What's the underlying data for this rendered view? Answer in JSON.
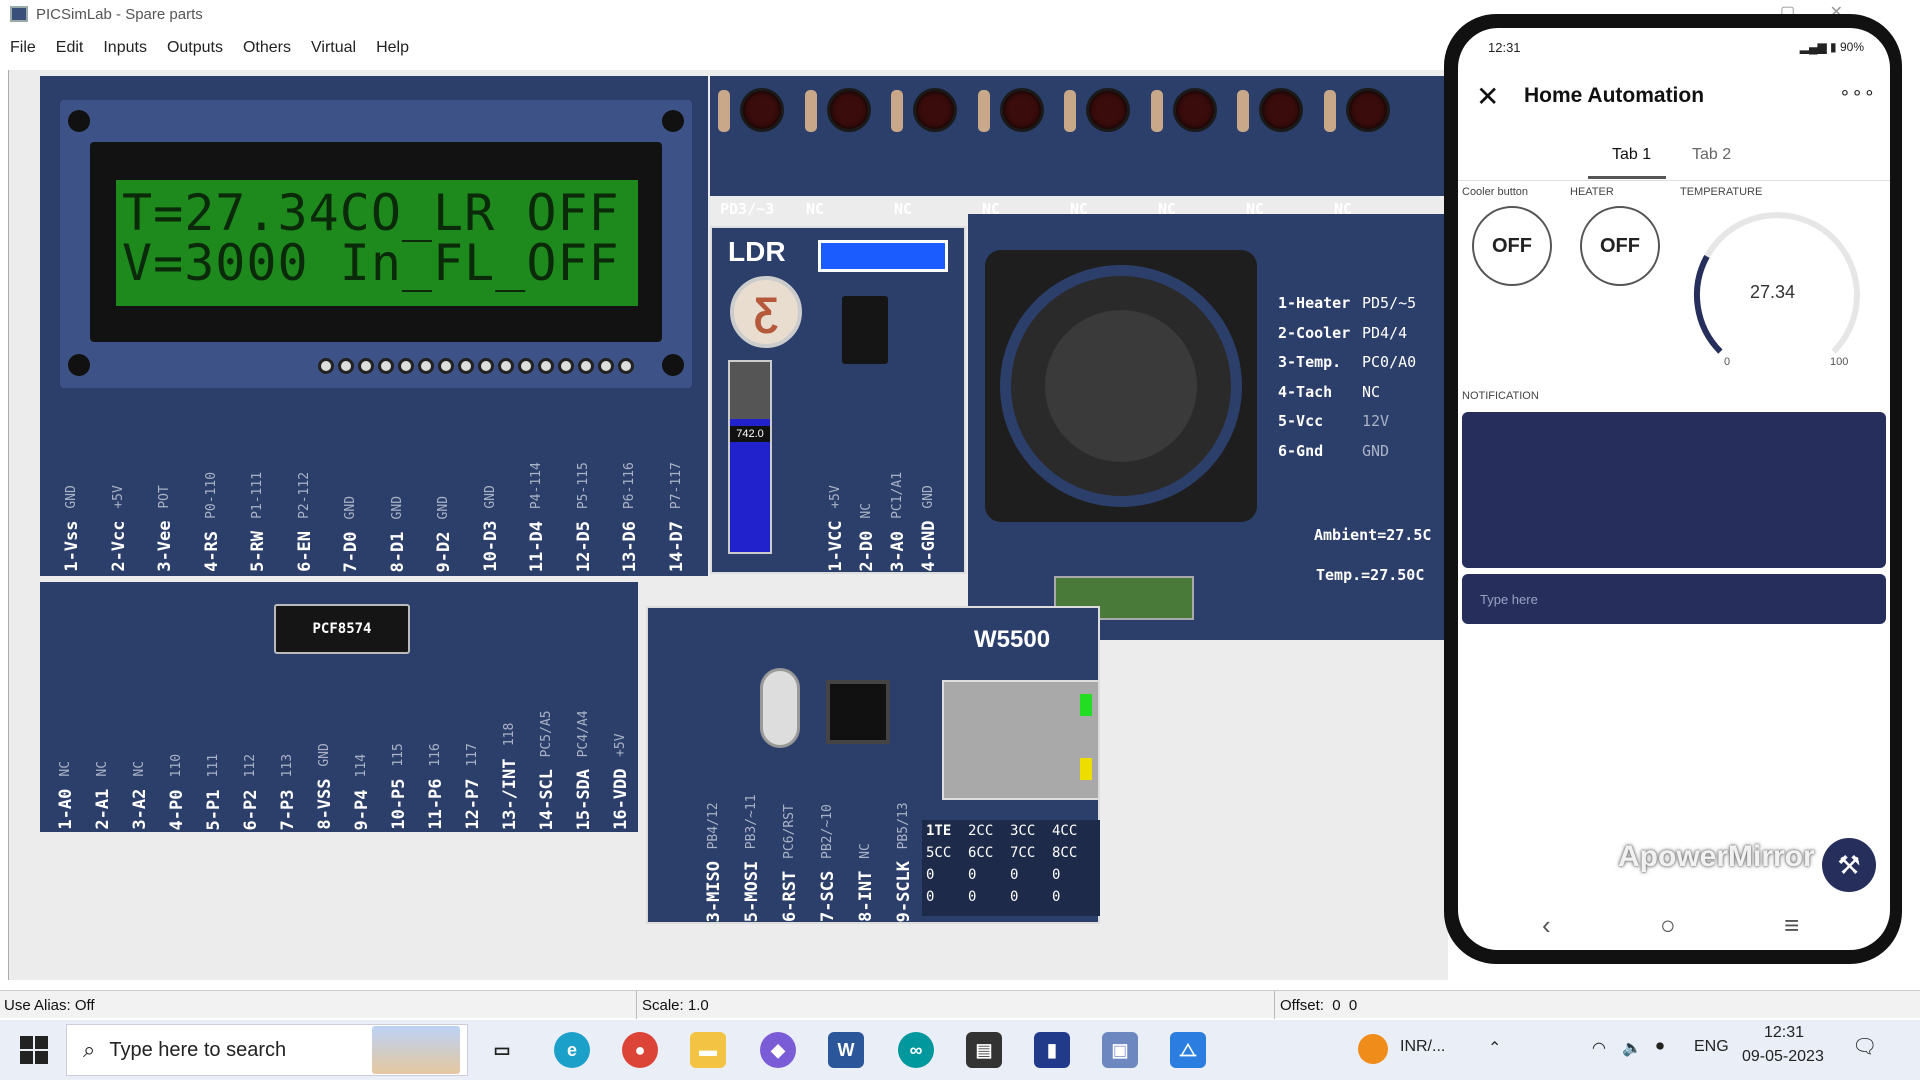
{
  "window": {
    "title": "PICSimLab - Spare parts"
  },
  "menu": [
    "File",
    "Edit",
    "Inputs",
    "Outputs",
    "Others",
    "Virtual",
    "Help"
  ],
  "lcd": {
    "line1": "T=27.34CO_LR OFF",
    "line2": "V=3000 In_FL_OFF",
    "pins": [
      {
        "name": "1-Vss",
        "sub": "GND"
      },
      {
        "name": "2-Vcc",
        "sub": "+5V"
      },
      {
        "name": "3-Vee",
        "sub": "POT"
      },
      {
        "name": "4-RS",
        "sub": "P0-110"
      },
      {
        "name": "5-RW",
        "sub": "P1-111"
      },
      {
        "name": "6-EN",
        "sub": "P2-112"
      },
      {
        "name": "7-D0",
        "sub": "GND"
      },
      {
        "name": "8-D1",
        "sub": "GND"
      },
      {
        "name": "9-D2",
        "sub": "GND"
      },
      {
        "name": "10-D3",
        "sub": "GND"
      },
      {
        "name": "11-D4",
        "sub": "P4-114"
      },
      {
        "name": "12-D5",
        "sub": "P5-115"
      },
      {
        "name": "13-D6",
        "sub": "P6-116"
      },
      {
        "name": "14-D7",
        "sub": "P7-117"
      }
    ]
  },
  "pcf": {
    "chip": "PCF8574",
    "pins": [
      {
        "name": "1-A0",
        "sub": "NC"
      },
      {
        "name": "2-A1",
        "sub": "NC"
      },
      {
        "name": "3-A2",
        "sub": "NC"
      },
      {
        "name": "4-P0",
        "sub": "110"
      },
      {
        "name": "5-P1",
        "sub": "111"
      },
      {
        "name": "6-P2",
        "sub": "112"
      },
      {
        "name": "7-P3",
        "sub": "113"
      },
      {
        "name": "8-VSS",
        "sub": "GND"
      },
      {
        "name": "9-P4",
        "sub": "114"
      },
      {
        "name": "10-P5",
        "sub": "115"
      },
      {
        "name": "11-P6",
        "sub": "116"
      },
      {
        "name": "12-P7",
        "sub": "117"
      },
      {
        "name": "13-/INT",
        "sub": "118"
      },
      {
        "name": "14-SCL",
        "sub": "PC5/A5"
      },
      {
        "name": "15-SDA",
        "sub": "PC4/A4"
      },
      {
        "name": "16-VDD",
        "sub": "+5V"
      }
    ]
  },
  "led_labels": [
    "PD3/~3",
    "NC",
    "NC",
    "NC",
    "NC",
    "NC",
    "NC",
    "NC"
  ],
  "ldr": {
    "title": "LDR",
    "value": "742.0",
    "level": 0.7,
    "pins": [
      {
        "name": "1-VCC",
        "sub": "+5V"
      },
      {
        "name": "2-D0",
        "sub": "NC"
      },
      {
        "name": "3-A0",
        "sub": "PC1/A1"
      },
      {
        "name": "4-GND",
        "sub": "GND"
      }
    ]
  },
  "fan": {
    "pins": [
      {
        "name": "1-Heater",
        "value": "PD5/~5"
      },
      {
        "name": "2-Cooler",
        "value": "PD4/4"
      },
      {
        "name": "3-Temp.",
        "value": "PC0/A0"
      },
      {
        "name": "4-Tach",
        "value": "NC"
      },
      {
        "name": "5-Vcc",
        "value": "12V"
      },
      {
        "name": "6-Gnd",
        "value": "GND"
      }
    ],
    "ambient": "Ambient=27.5C",
    "temp": "Temp.=27.50C"
  },
  "w5500": {
    "title": "W5500",
    "pins": [
      {
        "name": "3-MISO",
        "sub": "PB4/12"
      },
      {
        "name": "5-MOSI",
        "sub": "PB3/~11"
      },
      {
        "name": "6-RST",
        "sub": "PC6/RST"
      },
      {
        "name": "7-SCS",
        "sub": "PB2/~10"
      },
      {
        "name": "8-INT",
        "sub": "NC"
      },
      {
        "name": "9-SCLK",
        "sub": "PB5/13"
      }
    ],
    "table": [
      [
        "1TE",
        "2CC",
        "3CC",
        "4CC"
      ],
      [
        "5CC",
        "6CC",
        "7CC",
        "8CC"
      ],
      [
        "0",
        "0",
        "0",
        "0"
      ],
      [
        "0",
        "0",
        "0",
        "0"
      ]
    ]
  },
  "status": {
    "alias": "Use Alias: Off",
    "scale": "Scale: 1.0",
    "offset": "Offset:  0  0"
  },
  "phone": {
    "time": "12:31",
    "battery": "90%",
    "title": "Home Automation",
    "tabs": [
      "Tab 1",
      "Tab 2"
    ],
    "cooler_label": "Cooler button",
    "cooler_state": "OFF",
    "heater_label": "HEATER",
    "heater_state": "OFF",
    "temp_label": "TEMPERATURE",
    "temp_value": "27.34",
    "temp_value_num": 27.34,
    "gauge_min": "0",
    "gauge_max": "100",
    "notification_label": "NOTIFICATION",
    "input_placeholder": "Type here",
    "watermark": "ApowerMirror"
  },
  "taskbar": {
    "search_placeholder": "Type here to search",
    "currency": "INR/...",
    "lang": "ENG",
    "time": "12:31",
    "date": "09-05-2023"
  }
}
